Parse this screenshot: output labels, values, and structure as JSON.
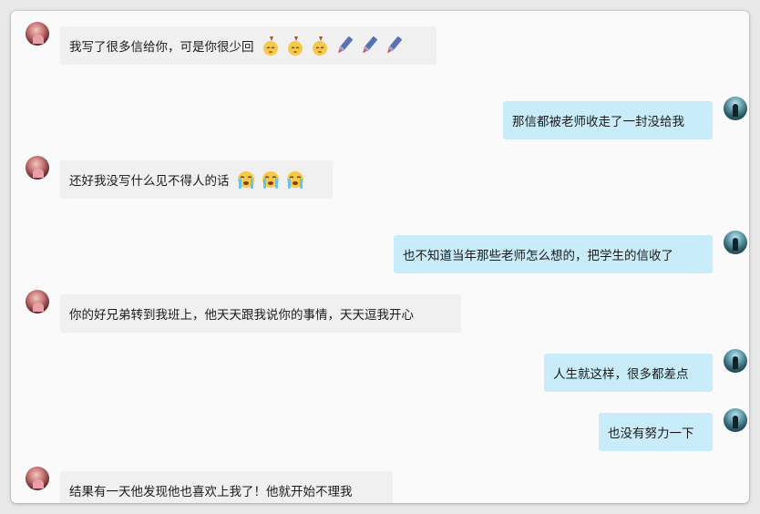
{
  "messages": [
    {
      "side": "left",
      "text": "我写了很多信给你，可是你很少回",
      "emojis": [
        "shy-face-icon",
        "shy-face-icon",
        "shy-face-icon",
        "knife-icon",
        "knife-icon",
        "knife-icon"
      ]
    },
    {
      "side": "right",
      "text": "那信都被老师收走了一封没给我",
      "emojis": []
    },
    {
      "side": "left",
      "text": "还好我没写什么见不得人的话",
      "emojis": [
        "crying-face-icon",
        "crying-face-icon",
        "crying-face-icon"
      ]
    },
    {
      "side": "right",
      "text": "也不知道当年那些老师怎么想的，把学生的信收了",
      "emojis": []
    },
    {
      "side": "left",
      "text": "你的好兄弟转到我班上，他天天跟我说你的事情，天天逗我开心",
      "emojis": []
    },
    {
      "side": "right",
      "text": "人生就这样，很多都差点",
      "emojis": []
    },
    {
      "side": "right",
      "text": "也没有努力一下",
      "emojis": []
    },
    {
      "side": "left",
      "text": "结果有一天他发现他也喜欢上我了！他就开始不理我",
      "emojis": []
    }
  ]
}
